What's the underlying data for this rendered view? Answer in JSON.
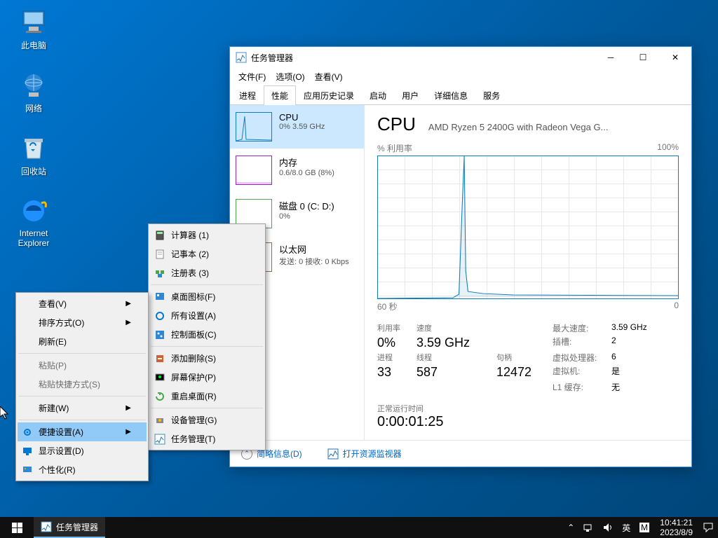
{
  "desktop_icons": [
    {
      "id": "this-pc",
      "label": "此电脑"
    },
    {
      "id": "network",
      "label": "网络"
    },
    {
      "id": "recycle-bin",
      "label": "回收站"
    },
    {
      "id": "ie",
      "label": "Internet\nExplorer"
    }
  ],
  "context_menu": {
    "items": [
      {
        "label": "查看(V)",
        "arrow": true
      },
      {
        "label": "排序方式(O)",
        "arrow": true
      },
      {
        "label": "刷新(E)"
      },
      {
        "sep": true
      },
      {
        "label": "粘贴(P)",
        "disabled": true
      },
      {
        "label": "粘贴快捷方式(S)",
        "disabled": true
      },
      {
        "sep": true
      },
      {
        "label": "新建(W)",
        "arrow": true
      },
      {
        "sep": true
      },
      {
        "label": "便捷设置(A)",
        "arrow": true,
        "highlighted": true,
        "icon": "gear"
      },
      {
        "label": "显示设置(D)",
        "icon": "display"
      },
      {
        "label": "个性化(R)",
        "icon": "personalize"
      }
    ]
  },
  "submenu": {
    "items": [
      {
        "label": "计算器 (1)",
        "icon": "calc"
      },
      {
        "label": "记事本 (2)",
        "icon": "notepad"
      },
      {
        "label": "注册表 (3)",
        "icon": "regedit"
      },
      {
        "sep": true
      },
      {
        "label": "桌面图标(F)",
        "icon": "desktop-icons"
      },
      {
        "label": "所有设置(A)",
        "icon": "settings"
      },
      {
        "label": "控制面板(C)",
        "icon": "control-panel"
      },
      {
        "sep": true
      },
      {
        "label": "添加删除(S)",
        "icon": "add-remove"
      },
      {
        "label": "屏幕保护(P)",
        "icon": "screensaver"
      },
      {
        "label": "重启桌面(R)",
        "icon": "restart"
      },
      {
        "sep": true
      },
      {
        "label": "设备管理(G)",
        "icon": "device-mgr"
      },
      {
        "label": "任务管理(T)",
        "icon": "taskmgr"
      }
    ]
  },
  "taskmgr": {
    "title": "任务管理器",
    "menubar": [
      "文件(F)",
      "选项(O)",
      "查看(V)"
    ],
    "tabs": [
      "进程",
      "性能",
      "应用历史记录",
      "启动",
      "用户",
      "详细信息",
      "服务"
    ],
    "active_tab": "性能",
    "cards": [
      {
        "name": "CPU",
        "detail": "0% 3.59 GHz",
        "color": "#117dbb",
        "selected": true
      },
      {
        "name": "内存",
        "detail": "0.6/8.0 GB (8%)",
        "color": "#9528b4"
      },
      {
        "name": "磁盘 0 (C: D:)",
        "detail": "0%",
        "color": "#4ca64c"
      },
      {
        "name": "以太网",
        "detail": "发送: 0 接收: 0 Kbps",
        "color": "#a66a2c"
      }
    ],
    "main": {
      "title": "CPU",
      "subtitle": "AMD Ryzen 5 2400G with Radeon Vega G...",
      "y_label": "% 利用率",
      "y_max": "100%",
      "x_left": "60 秒",
      "x_right": "0",
      "stats": {
        "util_label": "利用率",
        "util": "0%",
        "speed_label": "速度",
        "speed": "3.59 GHz",
        "proc_label": "进程",
        "proc": "33",
        "thread_label": "线程",
        "thread": "587",
        "handle_label": "句柄",
        "handle": "12472",
        "maxspeed_label": "最大速度:",
        "maxspeed": "3.59 GHz",
        "sockets_label": "插槽:",
        "sockets": "2",
        "vproc_label": "虚拟处理器:",
        "vproc": "6",
        "vm_label": "虚拟机:",
        "vm": "是",
        "l1_label": "L1 缓存:",
        "l1": "无"
      },
      "uptime_label": "正常运行时间",
      "uptime": "0:00:01:25"
    },
    "bottom": {
      "brief": "简略信息(D)",
      "resmon": "打开资源监视器"
    }
  },
  "taskbar": {
    "app": "任务管理器",
    "ime": "英",
    "clock_time": "10:41:21",
    "clock_date": "2023/8/9"
  },
  "chart_data": {
    "type": "line",
    "title": "CPU % 利用率",
    "xlabel": "秒",
    "ylabel": "% 利用率",
    "ylim": [
      0,
      100
    ],
    "xlim": [
      60,
      0
    ],
    "x": [
      60,
      55,
      50,
      45,
      44,
      43.5,
      43,
      42.8,
      42,
      40,
      38,
      36,
      34,
      32,
      30,
      28,
      26,
      24,
      22,
      20,
      18,
      16,
      14,
      12,
      10,
      8,
      6,
      4,
      2,
      0
    ],
    "values": [
      0,
      0,
      0,
      0,
      3,
      60,
      100,
      20,
      5,
      4,
      3,
      2,
      3,
      2,
      2,
      2,
      3,
      2,
      2,
      2,
      2,
      2,
      2,
      2,
      2,
      2,
      2,
      2,
      2,
      2
    ]
  }
}
